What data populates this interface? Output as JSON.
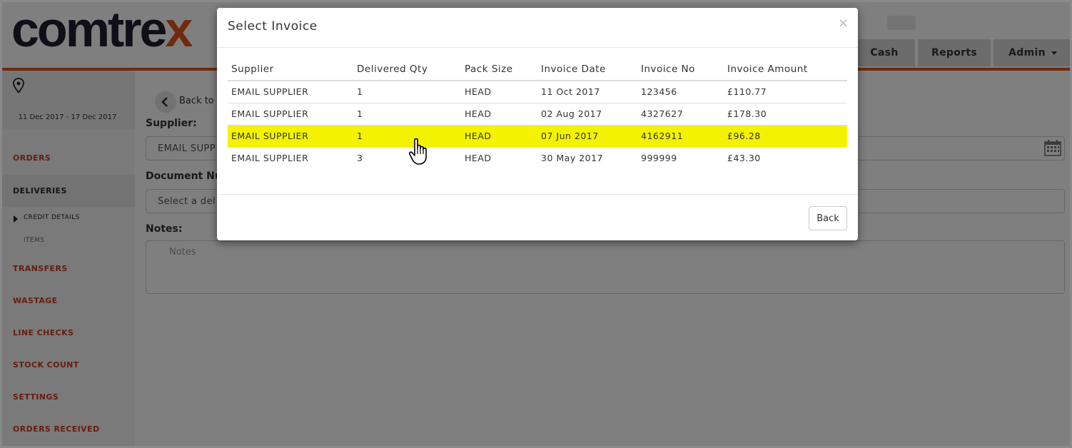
{
  "app": {
    "brand": {
      "main": "comtre",
      "accent": "x"
    },
    "nav": {
      "cash": "Cash",
      "reports": "Reports",
      "admin": "Admin"
    },
    "colors": {
      "accent": "#e2541b",
      "highlight": "#f3f300",
      "link": "#d13d1c"
    }
  },
  "sidebar": {
    "date_range": "11 Dec 2017 - 17 Dec 2017",
    "items": {
      "orders": "ORDERS",
      "deliveries": "DELIVERIES",
      "credit_details": "CREDIT DETAILS",
      "items": "ITEMS",
      "transfers": "TRANSFERS",
      "wastage": "WASTAGE",
      "line_checks": "LINE CHECKS",
      "stock_count": "STOCK COUNT",
      "settings": "SETTINGS",
      "orders_received": "ORDERS RECEIVED"
    }
  },
  "form": {
    "back_label": "Back to L",
    "supplier_label": "Supplier:",
    "supplier_value": "EMAIL SUPP",
    "document_label": "Document Num",
    "document_placeholder": "Select a del",
    "notes_label": "Notes:",
    "notes_placeholder": "Notes"
  },
  "modal": {
    "title": "Select Invoice",
    "close": "×",
    "columns": [
      "Supplier",
      "Delivered Qty",
      "Pack Size",
      "Invoice Date",
      "Invoice No",
      "Invoice Amount"
    ],
    "rows": [
      [
        "EMAIL SUPPLIER",
        "1",
        "HEAD",
        "11 Oct 2017",
        "123456",
        "£110.77"
      ],
      [
        "EMAIL SUPPLIER",
        "1",
        "HEAD",
        "02 Aug 2017",
        "4327627",
        "£178.30"
      ],
      [
        "EMAIL SUPPLIER",
        "1",
        "HEAD",
        "07 Jun 2017",
        "4162911",
        "£96.28"
      ],
      [
        "EMAIL SUPPLIER",
        "3",
        "HEAD",
        "30 May 2017",
        "999999",
        "£43.30"
      ]
    ],
    "back_button": "Back"
  },
  "icons": {
    "location": "map-pin-icon",
    "back": "chevron-left-icon",
    "calendar": "calendar-icon",
    "close": "close-icon",
    "cursor": "hand-pointer-icon"
  }
}
